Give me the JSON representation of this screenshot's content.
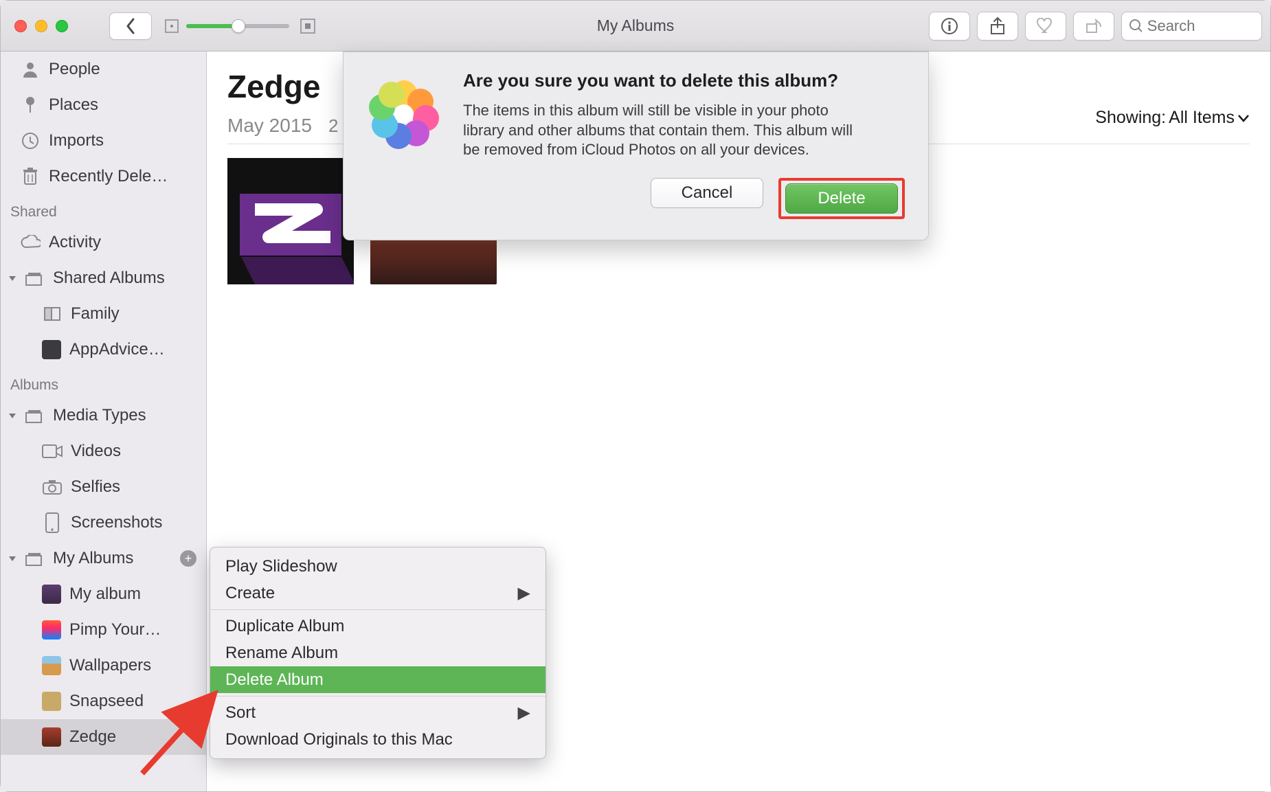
{
  "titlebar": {
    "title": "My Albums",
    "search_placeholder": "Search"
  },
  "sidebar": {
    "top_items": [
      {
        "label": "People"
      },
      {
        "label": "Places"
      },
      {
        "label": "Imports"
      },
      {
        "label": "Recently Dele…"
      }
    ],
    "shared_header": "Shared",
    "activity_label": "Activity",
    "shared_albums_label": "Shared Albums",
    "shared_children": [
      {
        "label": "Family"
      },
      {
        "label": "AppAdvice…"
      }
    ],
    "albums_header": "Albums",
    "media_types_label": "Media Types",
    "media_children": [
      {
        "label": "Videos"
      },
      {
        "label": "Selfies"
      },
      {
        "label": "Screenshots"
      }
    ],
    "my_albums_label": "My Albums",
    "my_albums_children": [
      {
        "label": "My album"
      },
      {
        "label": "Pimp Your…"
      },
      {
        "label": "Wallpapers"
      },
      {
        "label": "Snapseed"
      },
      {
        "label": "Zedge"
      }
    ]
  },
  "content": {
    "title": "Zedge",
    "date": "May 2015",
    "count": "2",
    "showing_label": "Showing:",
    "showing_value": "All Items"
  },
  "context_menu": {
    "items": [
      {
        "label": "Play Slideshow"
      },
      {
        "label": "Create",
        "submenu": true
      },
      {
        "label": "Duplicate Album"
      },
      {
        "label": "Rename Album"
      },
      {
        "label": "Delete Album",
        "highlighted": true
      },
      {
        "label": "Sort",
        "submenu": true
      },
      {
        "label": "Download Originals to this Mac"
      }
    ]
  },
  "dialog": {
    "title": "Are you sure you want to delete this album?",
    "body": "The items in this album will still be visible in your photo library and other albums that contain them. This album will be removed from iCloud Photos on all your devices.",
    "cancel": "Cancel",
    "delete": "Delete"
  }
}
